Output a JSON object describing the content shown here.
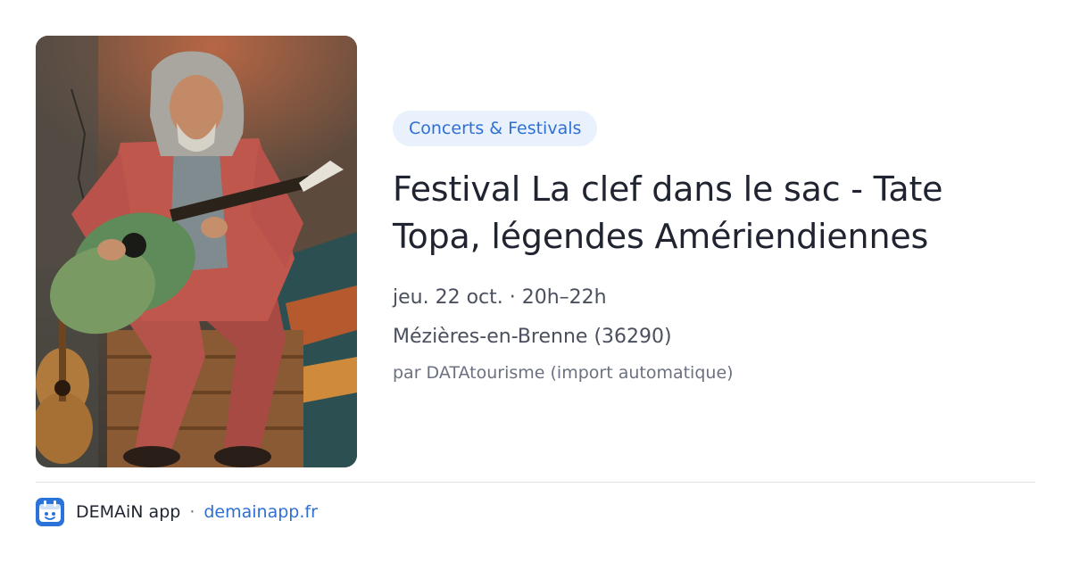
{
  "event": {
    "category": "Concerts & Festivals",
    "title": "Festival La clef dans le sac - Tate Topa, légendes Amériendiennes",
    "datetime": "jeu. 22 oct. · 20h–22h",
    "location": "Mézières-en-Brenne (36290)",
    "source": "par DATAtourisme (import automatique)",
    "image_alt": "Tate Topa"
  },
  "footer": {
    "app_name": "DEMAiN app",
    "separator": "·",
    "url": "demainapp.fr",
    "logo_icon": "demain-app-logo-icon"
  },
  "colors": {
    "accent": "#2f6fd3",
    "pill_bg": "#e9f1fc",
    "title": "#1f2430",
    "logo_bg": "#2b73d9"
  }
}
